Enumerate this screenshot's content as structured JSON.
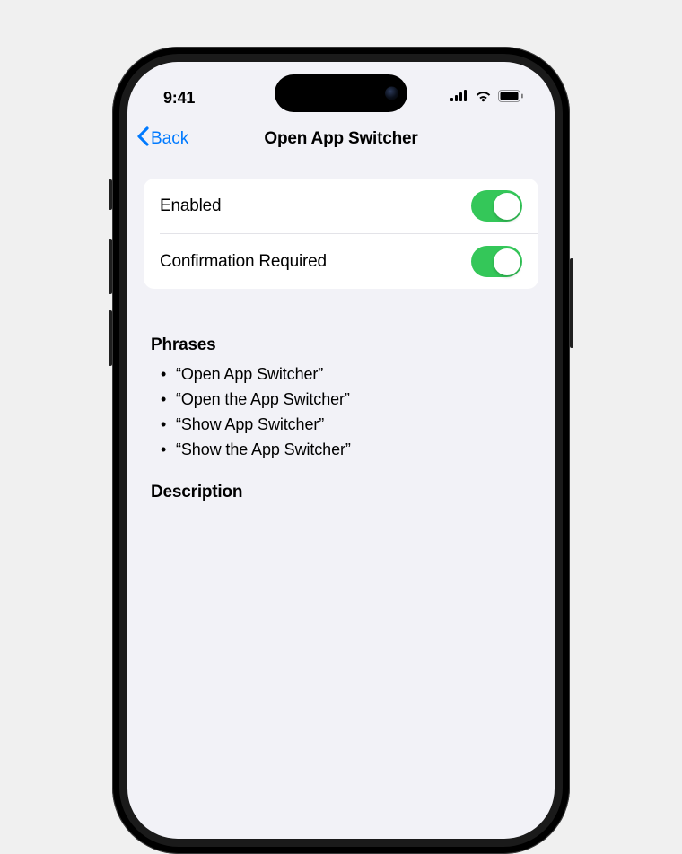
{
  "status": {
    "time": "9:41"
  },
  "nav": {
    "back_label": "Back",
    "title": "Open App Switcher"
  },
  "toggles": {
    "enabled": {
      "label": "Enabled",
      "on": true
    },
    "confirmation": {
      "label": "Confirmation Required",
      "on": true
    }
  },
  "phrases": {
    "header": "Phrases",
    "items": [
      "“Open App Switcher”",
      "“Open the App Switcher”",
      "“Show App Switcher”",
      "“Show the App Switcher”"
    ]
  },
  "description": {
    "header": "Description"
  }
}
